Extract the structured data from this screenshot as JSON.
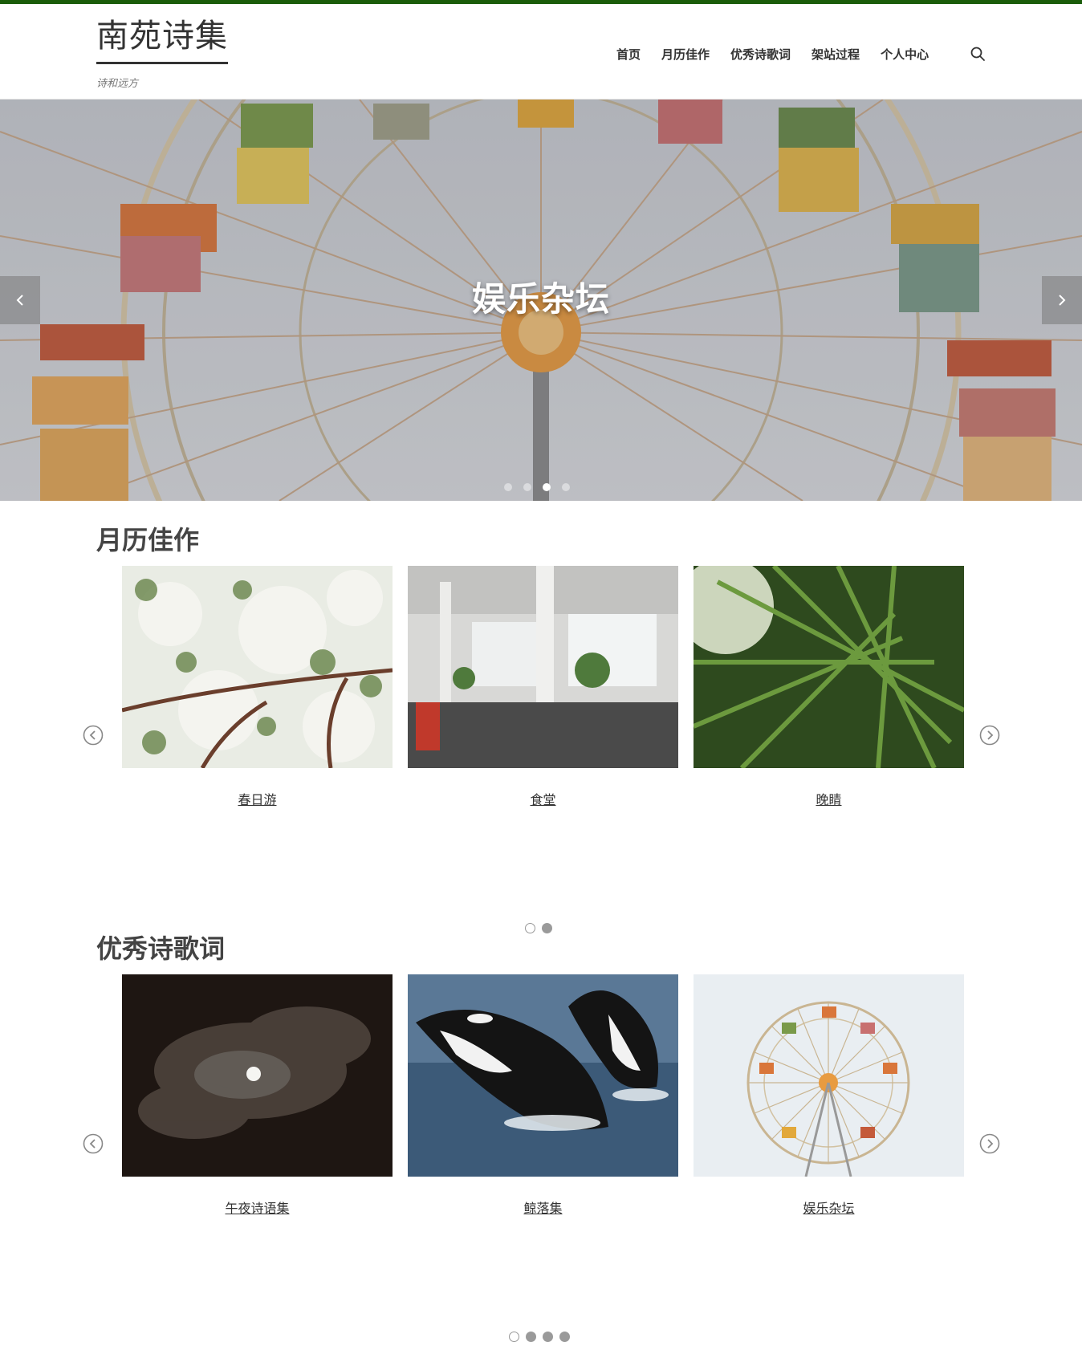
{
  "site": {
    "title": "南苑诗集",
    "tagline": "诗和远方",
    "accent_color": "#1a5c0a"
  },
  "nav": {
    "items": [
      {
        "label": "首页"
      },
      {
        "label": "月历佳作"
      },
      {
        "label": "优秀诗歌词"
      },
      {
        "label": "架站过程"
      },
      {
        "label": "个人中心"
      }
    ],
    "search_icon": "search-icon"
  },
  "hero": {
    "caption": "娱乐杂坛",
    "prev_icon": "chevron-left-icon",
    "next_icon": "chevron-right-icon",
    "slide_count": 4,
    "active_slide": 3
  },
  "sections": [
    {
      "title": "月历佳作",
      "cards": [
        {
          "caption": "春日游",
          "image": "blossom-branches-photo"
        },
        {
          "caption": "食堂",
          "image": "open-office-interior-photo"
        },
        {
          "caption": "晚睛",
          "image": "palm-leaf-photo"
        }
      ],
      "page_count": 2,
      "active_page": 1
    },
    {
      "title": "优秀诗歌词",
      "cards": [
        {
          "caption": "午夜诗语集",
          "image": "moon-clouds-night-photo"
        },
        {
          "caption": "鲸落集",
          "image": "orca-jumping-photo"
        },
        {
          "caption": "娱乐杂坛",
          "image": "ferris-wheel-photo"
        }
      ],
      "page_count": 4,
      "active_page": 1
    }
  ]
}
